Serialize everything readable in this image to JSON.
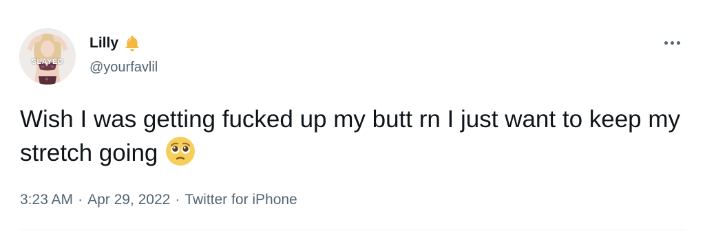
{
  "author": {
    "display_name": "Lilly",
    "handle": "@yourfavlil",
    "avatar_caption": "SLAYED",
    "badge_icon": "bell-icon"
  },
  "tweet": {
    "text": "Wish I was getting fucked up my butt rn I just want to keep my stretch going",
    "emoji": "pleading-face-emoji"
  },
  "meta": {
    "time": "3:23 AM",
    "separator": "·",
    "date": "Apr 29, 2022",
    "source": "Twitter for iPhone"
  },
  "more_icon": "more-options-icon",
  "colors": {
    "text": "#0f1419",
    "secondary": "#536471",
    "bell": "#f4b73f",
    "divider": "#eff3f4"
  }
}
